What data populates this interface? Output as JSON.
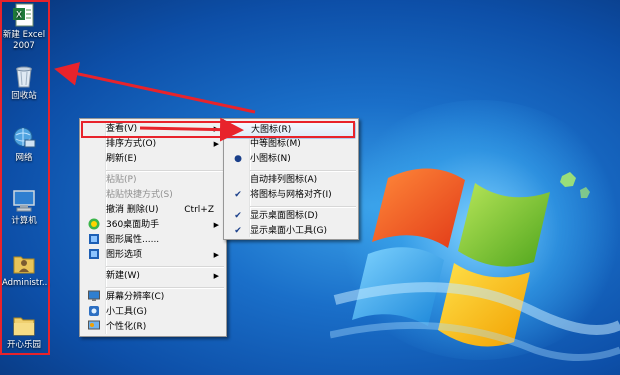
{
  "desktop": {
    "icons": [
      {
        "label": "新建 Excel 2007",
        "icon": "excel-file-icon"
      },
      {
        "label": "回收站",
        "icon": "recycle-bin-icon"
      },
      {
        "label": "网络",
        "icon": "network-icon"
      },
      {
        "label": "计算机",
        "icon": "computer-icon"
      },
      {
        "label": "Administr...",
        "icon": "user-folder-icon"
      },
      {
        "label": "开心乐园",
        "icon": "folder-icon"
      }
    ]
  },
  "context_menu": {
    "items": [
      {
        "label": "查看(V)",
        "has_submenu": true,
        "enabled": true
      },
      {
        "label": "排序方式(O)",
        "has_submenu": true,
        "enabled": true
      },
      {
        "label": "刷新(E)",
        "enabled": true
      },
      {
        "label": "粘贴(P)",
        "enabled": false
      },
      {
        "label": "粘贴快捷方式(S)",
        "enabled": false
      },
      {
        "label": "撤消 删除(U)",
        "shortcut": "Ctrl+Z",
        "enabled": true
      },
      {
        "label": "360桌面助手",
        "has_submenu": true,
        "enabled": true,
        "icon": "360-icon"
      },
      {
        "label": "图形属性......",
        "enabled": true,
        "icon": "graphics-icon"
      },
      {
        "label": "图形选项",
        "has_submenu": true,
        "enabled": true,
        "icon": "graphics-icon"
      },
      {
        "label": "新建(W)",
        "has_submenu": true,
        "enabled": true
      },
      {
        "label": "屏幕分辨率(C)",
        "enabled": true,
        "icon": "display-icon"
      },
      {
        "label": "小工具(G)",
        "enabled": true,
        "icon": "gadget-icon"
      },
      {
        "label": "个性化(R)",
        "enabled": true,
        "icon": "personalize-icon"
      }
    ]
  },
  "view_submenu": {
    "items": [
      {
        "label": "大图标(R)",
        "mark": ""
      },
      {
        "label": "中等图标(M)",
        "mark": ""
      },
      {
        "label": "小图标(N)",
        "mark": "●"
      },
      {
        "label": "自动排列图标(A)",
        "mark": ""
      },
      {
        "label": "将图标与网格对齐(I)",
        "mark": "✔"
      },
      {
        "label": "显示桌面图标(D)",
        "mark": "✔"
      },
      {
        "label": "显示桌面小工具(G)",
        "mark": "✔"
      }
    ]
  },
  "colors": {
    "annotation": "#e8232b",
    "desktop": "#1a6fc9"
  }
}
